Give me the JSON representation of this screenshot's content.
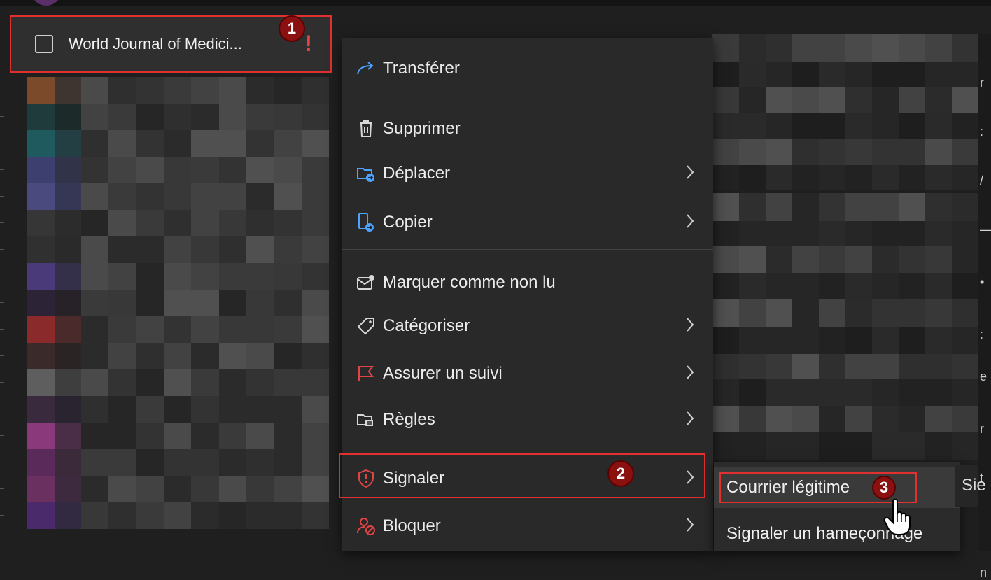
{
  "message_list": {
    "selected": {
      "sender": "World Journal of Medici...",
      "flag_icon": "important-icon"
    }
  },
  "context_menu": {
    "items": [
      {
        "key": "forward",
        "label": "Transférer",
        "icon": "forward-icon",
        "has_submenu": false
      },
      {
        "key": "delete",
        "label": "Supprimer",
        "icon": "trash-icon",
        "has_submenu": false
      },
      {
        "key": "move",
        "label": "Déplacer",
        "icon": "move-folder-icon",
        "has_submenu": true
      },
      {
        "key": "copy",
        "label": "Copier",
        "icon": "copy-icon",
        "has_submenu": true
      },
      {
        "key": "mark_unread",
        "label": "Marquer comme non lu",
        "icon": "mark-unread-icon",
        "has_submenu": false
      },
      {
        "key": "categorize",
        "label": "Catégoriser",
        "icon": "tag-icon",
        "has_submenu": true
      },
      {
        "key": "follow_up",
        "label": "Assurer un suivi",
        "icon": "flag-icon",
        "has_submenu": true
      },
      {
        "key": "rules",
        "label": "Règles",
        "icon": "rules-folder-icon",
        "has_submenu": true
      },
      {
        "key": "report",
        "label": "Signaler",
        "icon": "shield-alert-icon",
        "has_submenu": true
      },
      {
        "key": "block",
        "label": "Bloquer",
        "icon": "block-user-icon",
        "has_submenu": true
      }
    ]
  },
  "report_submenu": {
    "items": [
      {
        "label": "Courrier légitime"
      },
      {
        "label": "Signaler un hameçonnage"
      }
    ]
  },
  "annotations": {
    "step1": "1",
    "step2": "2",
    "step3": "3"
  },
  "peek": {
    "right_text": "Sie"
  },
  "colors": {
    "highlight": "#e03030",
    "badge": "#8b1010",
    "accent_blue": "#4da3ff"
  }
}
